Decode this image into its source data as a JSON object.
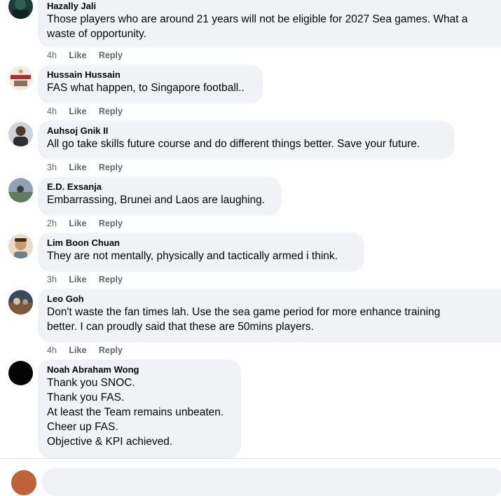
{
  "comments": [
    {
      "author": "Hazally Jali",
      "lines": [
        "Those players who are around 21 years will not be eligible for 2027 Sea games. What a",
        "waste of opportunity."
      ],
      "time": "4h",
      "like_label": "Like",
      "reply_label": "Reply",
      "avatar_icon": "profile-photo-icon"
    },
    {
      "author": "Hussain Hussain",
      "lines": [
        "FAS what happen, to Singapore football.."
      ],
      "time": "4h",
      "like_label": "Like",
      "reply_label": "Reply",
      "avatar_icon": "champions-logo-icon"
    },
    {
      "author": "Auhsoj Gnik II",
      "lines": [
        "All go take skills future course and do different things better. Save your future."
      ],
      "time": "3h",
      "like_label": "Like",
      "reply_label": "Reply",
      "avatar_icon": "profile-photo-icon"
    },
    {
      "author": "E.D. Exsanja",
      "lines": [
        "Embarrassing, Brunei and Laos are laughing."
      ],
      "time": "2h",
      "like_label": "Like",
      "reply_label": "Reply",
      "avatar_icon": "profile-photo-icon"
    },
    {
      "author": "Lim Boon Chuan",
      "lines": [
        "They are not mentally, physically and tactically armed i think."
      ],
      "time": "3h",
      "like_label": "Like",
      "reply_label": "Reply",
      "avatar_icon": "profile-photo-icon"
    },
    {
      "author": "Leo Goh",
      "lines": [
        "Don't waste the fan times lah. Use the sea game period for more enhance training",
        "better. I can proudly said that these are 50mins players."
      ],
      "time": "4h",
      "like_label": "Like",
      "reply_label": "Reply",
      "avatar_icon": "profile-photo-icon"
    },
    {
      "author": "Noah Abraham Wong",
      "lines": [
        "Thank you SNOC.",
        "Thank you FAS.",
        "At least the Team remains unbeaten.",
        "Cheer up FAS.",
        "Objective & KPI achieved."
      ],
      "time": "",
      "like_label": "",
      "reply_label": "",
      "avatar_icon": "profile-photo-icon"
    }
  ],
  "colors": {
    "bubble": "#f0f2f5",
    "meta_text": "#65676b",
    "body_text": "#050505"
  }
}
